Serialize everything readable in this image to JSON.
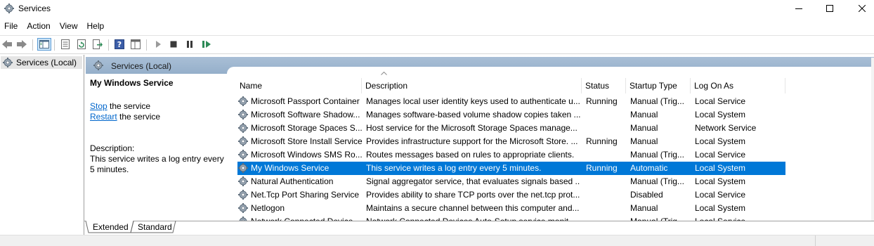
{
  "window": {
    "title": "Services"
  },
  "menu": [
    "File",
    "Action",
    "View",
    "Help"
  ],
  "tree": {
    "root_label": "Services (Local)"
  },
  "panel": {
    "header_label": "Services (Local)"
  },
  "description_pane": {
    "service_name": "My Windows Service",
    "stop_link": "Stop",
    "stop_suffix": " the service",
    "restart_link": "Restart",
    "restart_suffix": " the service",
    "description_label": "Description:",
    "description_text": "This service writes a log entry every 5 minutes."
  },
  "table": {
    "columns": [
      "Name",
      "Description",
      "Status",
      "Startup Type",
      "Log On As"
    ],
    "rows": [
      {
        "name": "Microsoft Passport Container",
        "description": "Manages local user identity keys used to authenticate u...",
        "status": "Running",
        "startup": "Manual (Trig...",
        "logon": "Local Service",
        "selected": false
      },
      {
        "name": "Microsoft Software Shadow...",
        "description": "Manages software-based volume shadow copies taken ...",
        "status": "",
        "startup": "Manual",
        "logon": "Local System",
        "selected": false
      },
      {
        "name": "Microsoft Storage Spaces S...",
        "description": "Host service for the Microsoft Storage Spaces manage...",
        "status": "",
        "startup": "Manual",
        "logon": "Network Service",
        "selected": false
      },
      {
        "name": "Microsoft Store Install Service",
        "description": "Provides infrastructure support for the Microsoft Store. ...",
        "status": "Running",
        "startup": "Manual",
        "logon": "Local System",
        "selected": false
      },
      {
        "name": "Microsoft Windows SMS Ro...",
        "description": "Routes messages based on rules to appropriate clients.",
        "status": "",
        "startup": "Manual (Trig...",
        "logon": "Local Service",
        "selected": false
      },
      {
        "name": "My Windows Service",
        "description": "This service writes a log entry every 5 minutes.",
        "status": "Running",
        "startup": "Automatic",
        "logon": "Local System",
        "selected": true
      },
      {
        "name": "Natural Authentication",
        "description": "Signal aggregator service, that evaluates signals based ...",
        "status": "",
        "startup": "Manual (Trig...",
        "logon": "Local System",
        "selected": false
      },
      {
        "name": "Net.Tcp Port Sharing Service",
        "description": "Provides ability to share TCP ports over the net.tcp prot...",
        "status": "",
        "startup": "Disabled",
        "logon": "Local Service",
        "selected": false
      },
      {
        "name": "Netlogon",
        "description": "Maintains a secure channel between this computer and...",
        "status": "",
        "startup": "Manual",
        "logon": "Local System",
        "selected": false
      },
      {
        "name": "Network Connected Device...",
        "description": "Network Connected Devices Auto-Setup service monit...",
        "status": "",
        "startup": "Manual (Trig...",
        "logon": "Local Service",
        "selected": false
      }
    ]
  },
  "tabs": [
    "Extended",
    "Standard"
  ],
  "colors": {
    "selection": "#0078d7",
    "link": "#0066cc",
    "header_band": "#a9bfd6"
  },
  "icons": [
    "services-gear-icon",
    "back-arrow-icon",
    "forward-arrow-icon",
    "show-hide-console-tree-icon",
    "properties-icon",
    "refresh-icon",
    "export-list-icon",
    "help-icon",
    "view-icon",
    "start-service-icon",
    "stop-service-icon",
    "pause-service-icon",
    "restart-service-icon"
  ]
}
